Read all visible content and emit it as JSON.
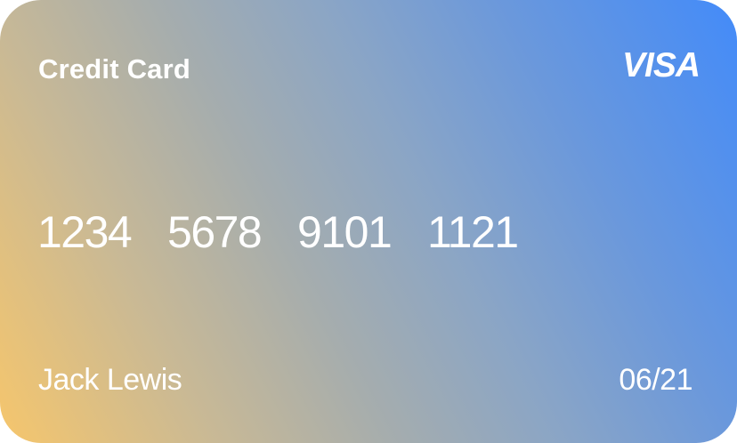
{
  "card": {
    "title": "Credit Card",
    "brand": "VISA",
    "number": "1234  5678  9101  1121",
    "holder_name": "Jack Lewis",
    "expiry": "06/21"
  },
  "colors": {
    "gradient_start": "#f6c66c",
    "gradient_end": "#438bf9",
    "text": "#ffffff"
  }
}
